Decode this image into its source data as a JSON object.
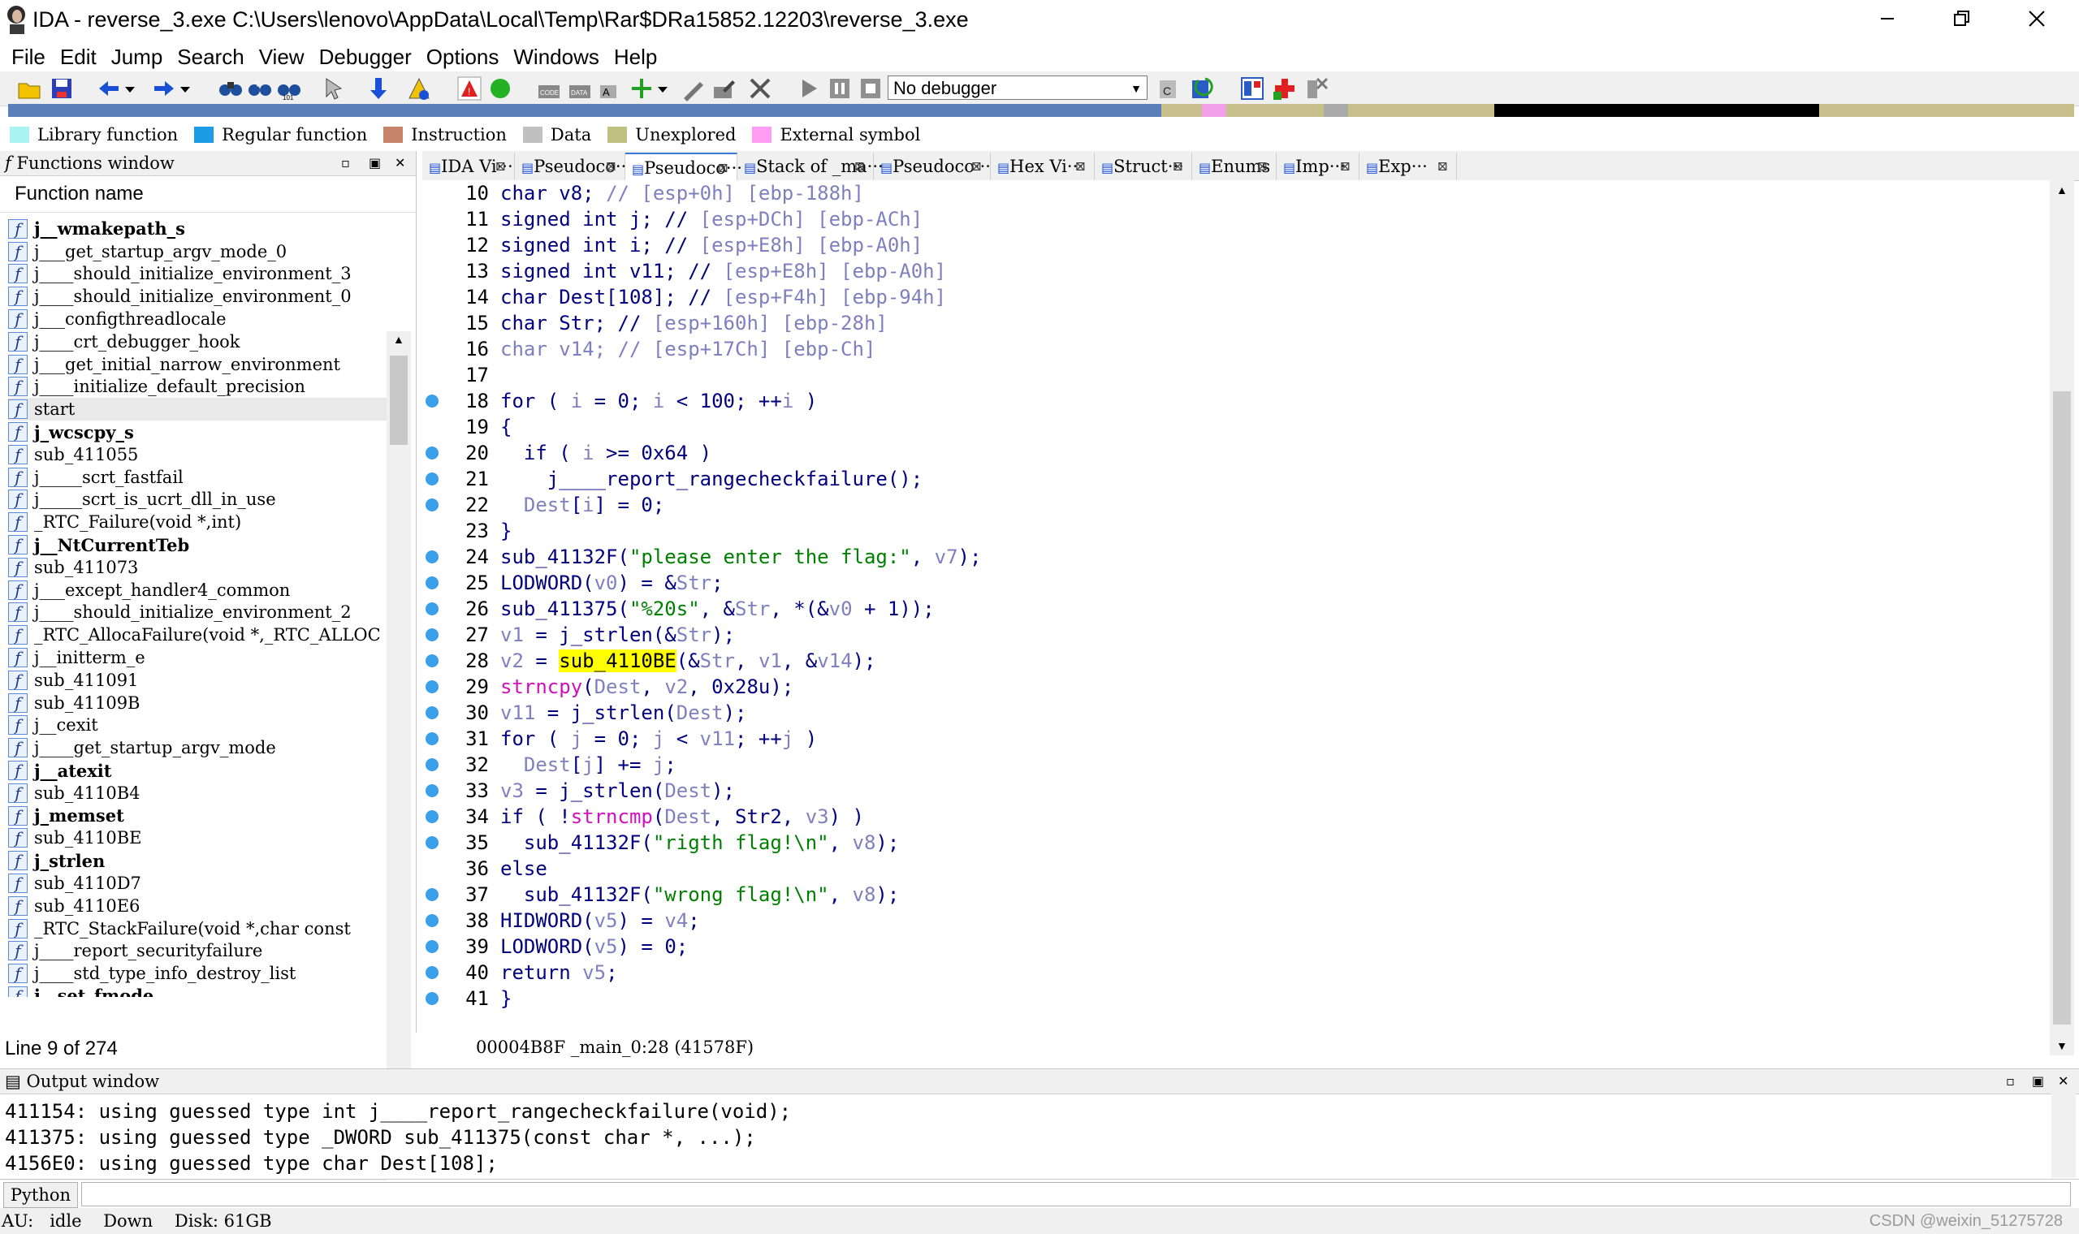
{
  "window": {
    "title": "IDA - reverse_3.exe C:\\Users\\lenovo\\AppData\\Local\\Temp\\Rar$DRa15852.12203\\reverse_3.exe"
  },
  "menu": [
    "File",
    "Edit",
    "Jump",
    "Search",
    "View",
    "Debugger",
    "Options",
    "Windows",
    "Help"
  ],
  "toolbar": {
    "debugger_value": "No debugger"
  },
  "legend": [
    {
      "label": "Library function",
      "color": "#aaf3f3"
    },
    {
      "label": "Regular function",
      "color": "#1a9be6"
    },
    {
      "label": "Instruction",
      "color": "#c8846a"
    },
    {
      "label": "Data",
      "color": "#c0c0c0"
    },
    {
      "label": "Unexplored",
      "color": "#c0c080"
    },
    {
      "label": "External symbol",
      "color": "#ff9cf4"
    }
  ],
  "functions_window": {
    "title": "Functions window",
    "column": "Function name",
    "items": [
      {
        "name": "j__wmakepath_s",
        "bold": true
      },
      {
        "name": "j___get_startup_argv_mode_0",
        "bold": false
      },
      {
        "name": "j____should_initialize_environment_3",
        "bold": false
      },
      {
        "name": "j____should_initialize_environment_0",
        "bold": false
      },
      {
        "name": "j___configthreadlocale",
        "bold": false
      },
      {
        "name": "j____crt_debugger_hook",
        "bold": false
      },
      {
        "name": "j___get_initial_narrow_environment",
        "bold": false
      },
      {
        "name": "j____initialize_default_precision",
        "bold": false
      },
      {
        "name": "start",
        "bold": false,
        "selected": true
      },
      {
        "name": "j_wcscpy_s",
        "bold": true
      },
      {
        "name": "sub_411055",
        "bold": false
      },
      {
        "name": "j_____scrt_fastfail",
        "bold": false
      },
      {
        "name": "j_____scrt_is_ucrt_dll_in_use",
        "bold": false
      },
      {
        "name": "_RTC_Failure(void *,int)",
        "bold": false
      },
      {
        "name": "j__NtCurrentTeb",
        "bold": true
      },
      {
        "name": "sub_411073",
        "bold": false
      },
      {
        "name": "j___except_handler4_common",
        "bold": false
      },
      {
        "name": "j____should_initialize_environment_2",
        "bold": false
      },
      {
        "name": "_RTC_AllocaFailure(void *,_RTC_ALLOC",
        "bold": false
      },
      {
        "name": "j__initterm_e",
        "bold": false
      },
      {
        "name": "sub_411091",
        "bold": false
      },
      {
        "name": "sub_41109B",
        "bold": false
      },
      {
        "name": "j__cexit",
        "bold": false
      },
      {
        "name": "j____get_startup_argv_mode",
        "bold": false
      },
      {
        "name": "j__atexit",
        "bold": true
      },
      {
        "name": "sub_4110B4",
        "bold": false
      },
      {
        "name": "j_memset",
        "bold": true
      },
      {
        "name": "sub_4110BE",
        "bold": false
      },
      {
        "name": "j_strlen",
        "bold": true
      },
      {
        "name": "sub_4110D7",
        "bold": false
      },
      {
        "name": "sub_4110E6",
        "bold": false
      },
      {
        "name": "_RTC_StackFailure(void *,char const",
        "bold": false
      },
      {
        "name": "j____report_securityfailure",
        "bold": false
      },
      {
        "name": "j____std_type_info_destroy_list",
        "bold": false
      },
      {
        "name": "j__set_fmode",
        "bold": true
      }
    ],
    "status": "Line 9 of 274"
  },
  "tabs": [
    {
      "label": "IDA Vi···",
      "icon": "ida-view-icon"
    },
    {
      "label": "Pseudoco···",
      "icon": "pseudocode-icon"
    },
    {
      "label": "Pseudoco···",
      "icon": "pseudocode-icon",
      "active": true
    },
    {
      "label": "Stack of _ma···",
      "icon": "stack-icon"
    },
    {
      "label": "Pseudoco···",
      "icon": "pseudocode-icon"
    },
    {
      "label": "Hex Vi···",
      "icon": "hex-view-icon"
    },
    {
      "label": "Struct···",
      "icon": "struct-icon"
    },
    {
      "label": "Enums",
      "icon": "enums-icon"
    },
    {
      "label": "Imp···",
      "icon": "imports-icon"
    },
    {
      "label": "Exp···",
      "icon": "exports-icon"
    }
  ],
  "code": [
    {
      "n": "10",
      "dot": false,
      "t": [
        [
          "kw",
          "char "
        ],
        [
          "kw",
          "v8"
        ],
        [
          "kw",
          "; "
        ],
        [
          "cmt",
          "// [esp+0h] [ebp-188h]"
        ]
      ]
    },
    {
      "n": "11",
      "dot": false,
      "t": [
        [
          "kw",
          "signed int j; "
        ],
        [
          "kw",
          "// "
        ],
        [
          "cmt",
          "[esp+DCh] [ebp-ACh]"
        ]
      ]
    },
    {
      "n": "12",
      "dot": false,
      "t": [
        [
          "kw",
          "signed int i; "
        ],
        [
          "kw",
          "// "
        ],
        [
          "cmt",
          "[esp+E8h] [ebp-A0h]"
        ]
      ]
    },
    {
      "n": "13",
      "dot": false,
      "t": [
        [
          "kw",
          "signed int v11; "
        ],
        [
          "kw",
          "// "
        ],
        [
          "cmt",
          "[esp+E8h] [ebp-A0h]"
        ]
      ]
    },
    {
      "n": "14",
      "dot": false,
      "t": [
        [
          "kw",
          "char Dest[108]; "
        ],
        [
          "kw",
          "// "
        ],
        [
          "cmt",
          "[esp+F4h] [ebp-94h]"
        ]
      ]
    },
    {
      "n": "15",
      "dot": false,
      "t": [
        [
          "kw",
          "char Str; "
        ],
        [
          "kw",
          "// "
        ],
        [
          "cmt",
          "[esp+160h] [ebp-28h]"
        ]
      ]
    },
    {
      "n": "16",
      "dot": false,
      "t": [
        [
          "cmt",
          "char v14; // [esp+17Ch] [ebp-Ch]"
        ]
      ]
    },
    {
      "n": "17",
      "dot": false,
      "t": []
    },
    {
      "n": "18",
      "dot": true,
      "t": [
        [
          "kw",
          "for ( "
        ],
        [
          "var",
          "i"
        ],
        [
          "kw",
          " = 0; "
        ],
        [
          "var",
          "i"
        ],
        [
          "kw",
          " < 100; ++"
        ],
        [
          "var",
          "i"
        ],
        [
          "kw",
          " )"
        ]
      ]
    },
    {
      "n": "19",
      "dot": false,
      "t": [
        [
          "kw",
          "{"
        ]
      ]
    },
    {
      "n": "20",
      "dot": true,
      "t": [
        [
          "kw",
          "  if ( "
        ],
        [
          "var",
          "i"
        ],
        [
          "kw",
          " >= 0x64 )"
        ]
      ]
    },
    {
      "n": "21",
      "dot": true,
      "t": [
        [
          "fn",
          "    j____report_rangecheckfailure"
        ],
        [
          "kw",
          "();"
        ]
      ]
    },
    {
      "n": "22",
      "dot": true,
      "t": [
        [
          "var",
          "  Dest"
        ],
        [
          "kw",
          "["
        ],
        [
          "var",
          "i"
        ],
        [
          "kw",
          "] = 0;"
        ]
      ]
    },
    {
      "n": "23",
      "dot": false,
      "t": [
        [
          "kw",
          "}"
        ]
      ]
    },
    {
      "n": "24",
      "dot": true,
      "t": [
        [
          "fn",
          "sub_41132F"
        ],
        [
          "kw",
          "("
        ],
        [
          "str",
          "\"please enter the flag:\""
        ],
        [
          "kw",
          ", "
        ],
        [
          "var",
          "v7"
        ],
        [
          "kw",
          ");"
        ]
      ]
    },
    {
      "n": "25",
      "dot": true,
      "t": [
        [
          "fn",
          "LODWORD"
        ],
        [
          "kw",
          "("
        ],
        [
          "var",
          "v0"
        ],
        [
          "kw",
          ") = &"
        ],
        [
          "var",
          "Str"
        ],
        [
          "kw",
          ";"
        ]
      ]
    },
    {
      "n": "26",
      "dot": true,
      "t": [
        [
          "fn",
          "sub_411375"
        ],
        [
          "kw",
          "("
        ],
        [
          "str",
          "\"%20s\""
        ],
        [
          "kw",
          ", &"
        ],
        [
          "var",
          "Str"
        ],
        [
          "kw",
          ", *(&"
        ],
        [
          "var",
          "v0"
        ],
        [
          "kw",
          " + 1));"
        ]
      ]
    },
    {
      "n": "27",
      "dot": true,
      "t": [
        [
          "var",
          "v1"
        ],
        [
          "kw",
          " = "
        ],
        [
          "fn",
          "j_strlen"
        ],
        [
          "kw",
          "(&"
        ],
        [
          "var",
          "Str"
        ],
        [
          "kw",
          ");"
        ]
      ]
    },
    {
      "n": "28",
      "dot": true,
      "t": [
        [
          "var",
          "v2"
        ],
        [
          "kw",
          " = "
        ],
        [
          "hl",
          "sub_4110BE"
        ],
        [
          "kw",
          "(&"
        ],
        [
          "var",
          "Str"
        ],
        [
          "kw",
          ", "
        ],
        [
          "var",
          "v1"
        ],
        [
          "kw",
          ", &"
        ],
        [
          "var",
          "v14"
        ],
        [
          "kw",
          ");"
        ]
      ]
    },
    {
      "n": "29",
      "dot": true,
      "t": [
        [
          "imp",
          "strncpy"
        ],
        [
          "kw",
          "("
        ],
        [
          "var",
          "Dest"
        ],
        [
          "kw",
          ", "
        ],
        [
          "var",
          "v2"
        ],
        [
          "kw",
          ", 0x28u);"
        ]
      ]
    },
    {
      "n": "30",
      "dot": true,
      "t": [
        [
          "var",
          "v11"
        ],
        [
          "kw",
          " = "
        ],
        [
          "fn",
          "j_strlen"
        ],
        [
          "kw",
          "("
        ],
        [
          "var",
          "Dest"
        ],
        [
          "kw",
          ");"
        ]
      ]
    },
    {
      "n": "31",
      "dot": true,
      "t": [
        [
          "kw",
          "for ( "
        ],
        [
          "var",
          "j"
        ],
        [
          "kw",
          " = 0; "
        ],
        [
          "var",
          "j"
        ],
        [
          "kw",
          " < "
        ],
        [
          "var",
          "v11"
        ],
        [
          "kw",
          "; ++"
        ],
        [
          "var",
          "j"
        ],
        [
          "kw",
          " )"
        ]
      ]
    },
    {
      "n": "32",
      "dot": true,
      "t": [
        [
          "var",
          "  Dest"
        ],
        [
          "kw",
          "["
        ],
        [
          "var",
          "j"
        ],
        [
          "kw",
          "] += "
        ],
        [
          "var",
          "j"
        ],
        [
          "kw",
          ";"
        ]
      ]
    },
    {
      "n": "33",
      "dot": true,
      "t": [
        [
          "var",
          "v3"
        ],
        [
          "kw",
          " = "
        ],
        [
          "fn",
          "j_strlen"
        ],
        [
          "kw",
          "("
        ],
        [
          "var",
          "Dest"
        ],
        [
          "kw",
          ");"
        ]
      ]
    },
    {
      "n": "34",
      "dot": true,
      "t": [
        [
          "kw",
          "if ( !"
        ],
        [
          "imp",
          "strncmp"
        ],
        [
          "kw",
          "("
        ],
        [
          "var",
          "Dest"
        ],
        [
          "kw",
          ", Str2, "
        ],
        [
          "var",
          "v3"
        ],
        [
          "kw",
          ") )"
        ]
      ]
    },
    {
      "n": "35",
      "dot": true,
      "t": [
        [
          "fn",
          "  sub_41132F"
        ],
        [
          "kw",
          "("
        ],
        [
          "str",
          "\"rigth flag!\\n\""
        ],
        [
          "kw",
          ", "
        ],
        [
          "var",
          "v8"
        ],
        [
          "kw",
          ");"
        ]
      ]
    },
    {
      "n": "36",
      "dot": false,
      "t": [
        [
          "kw",
          "else"
        ]
      ]
    },
    {
      "n": "37",
      "dot": true,
      "t": [
        [
          "fn",
          "  sub_41132F"
        ],
        [
          "kw",
          "("
        ],
        [
          "str",
          "\"wrong flag!\\n\""
        ],
        [
          "kw",
          ", "
        ],
        [
          "var",
          "v8"
        ],
        [
          "kw",
          ");"
        ]
      ]
    },
    {
      "n": "38",
      "dot": true,
      "t": [
        [
          "fn",
          "HIDWORD"
        ],
        [
          "kw",
          "("
        ],
        [
          "var",
          "v5"
        ],
        [
          "kw",
          ") = "
        ],
        [
          "var",
          "v4"
        ],
        [
          "kw",
          ";"
        ]
      ]
    },
    {
      "n": "39",
      "dot": true,
      "t": [
        [
          "fn",
          "LODWORD"
        ],
        [
          "kw",
          "("
        ],
        [
          "var",
          "v5"
        ],
        [
          "kw",
          ") = 0;"
        ]
      ]
    },
    {
      "n": "40",
      "dot": true,
      "t": [
        [
          "kw",
          "return "
        ],
        [
          "var",
          "v5"
        ],
        [
          "kw",
          ";"
        ]
      ]
    },
    {
      "n": "41",
      "dot": true,
      "t": [
        [
          "kw",
          "}"
        ]
      ]
    }
  ],
  "code_status": "00004B8F _main_0:28 (41578F)",
  "output_window": {
    "title": "Output window",
    "lines": [
      "411154: using guessed type int j____report_rangecheckfailure(void);",
      "411375: using guessed type _DWORD sub_411375(const char *, ...);",
      "4156E0: using guessed type char Dest[108];"
    ]
  },
  "python": {
    "label": "Python"
  },
  "status": {
    "au_label": "AU:",
    "au_value": "idle",
    "direction": "Down",
    "disk": "Disk: 61GB"
  },
  "watermark": "CSDN @weixin_51275728"
}
